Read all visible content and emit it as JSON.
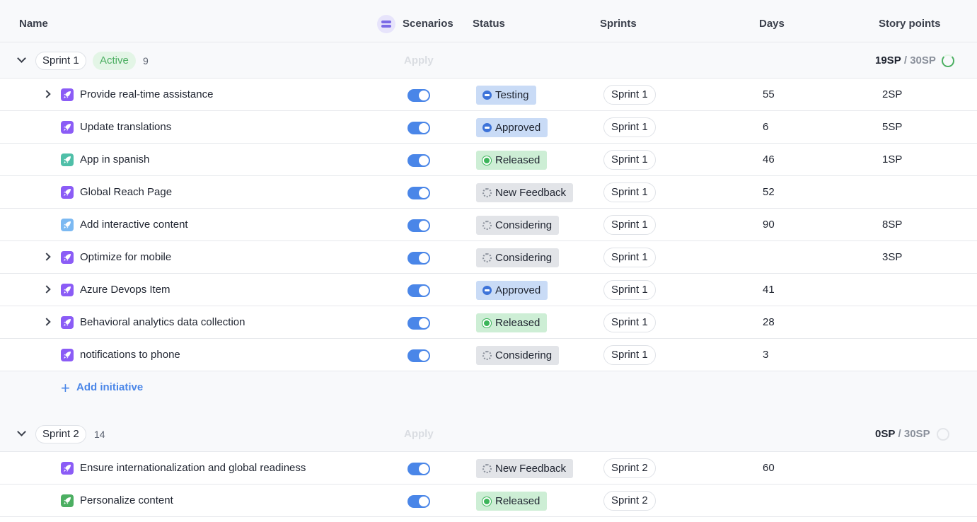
{
  "columns": {
    "name": "Name",
    "scenarios": "Scenarios",
    "status": "Status",
    "sprints": "Sprints",
    "days": "Days",
    "story_points": "Story points"
  },
  "colors": {
    "accent": "#4a86e8",
    "status_blue": "#3d73d9",
    "status_green": "#3cb55a",
    "status_grey": "#8a909b",
    "type_purple": "#8b5cf6",
    "type_teal": "#4fbfa8",
    "type_lightblue": "#7cb9f2",
    "type_green": "#4caf62"
  },
  "groups": [
    {
      "sprint": "Sprint 1",
      "badge": "Active",
      "count": "9",
      "apply": "Apply",
      "sp_used": "19SP",
      "sp_sep": "/",
      "sp_total": "30SP",
      "items": [
        {
          "name": "Provide real-time assistance",
          "expandable": true,
          "type_icon": "rocket-icon",
          "type_color": "#8b5cf6",
          "status": "Testing",
          "status_kind": "blue",
          "sprint": "Sprint 1",
          "days": "55",
          "points": "2SP"
        },
        {
          "name": "Update translations",
          "expandable": false,
          "type_icon": "rocket-icon",
          "type_color": "#8b5cf6",
          "status": "Approved",
          "status_kind": "blue",
          "sprint": "Sprint 1",
          "days": "6",
          "points": "5SP"
        },
        {
          "name": "App in spanish",
          "expandable": false,
          "type_icon": "rocket-icon",
          "type_color": "#4fbfa8",
          "status": "Released",
          "status_kind": "green",
          "sprint": "Sprint 1",
          "days": "46",
          "points": "1SP"
        },
        {
          "name": "Global Reach Page",
          "expandable": false,
          "type_icon": "rocket-icon",
          "type_color": "#8b5cf6",
          "status": "New Feedback",
          "status_kind": "grey",
          "sprint": "Sprint 1",
          "days": "52",
          "points": ""
        },
        {
          "name": "Add interactive content",
          "expandable": false,
          "type_icon": "rocket-icon",
          "type_color": "#7cb9f2",
          "status": "Considering",
          "status_kind": "grey",
          "sprint": "Sprint 1",
          "days": "90",
          "points": "8SP"
        },
        {
          "name": "Optimize for mobile",
          "expandable": true,
          "type_icon": "rocket-icon",
          "type_color": "#8b5cf6",
          "status": "Considering",
          "status_kind": "grey",
          "sprint": "Sprint 1",
          "days": "",
          "points": "3SP"
        },
        {
          "name": "Azure Devops Item",
          "expandable": true,
          "type_icon": "rocket-icon",
          "type_color": "#8b5cf6",
          "status": "Approved",
          "status_kind": "blue",
          "sprint": "Sprint 1",
          "days": "41",
          "points": ""
        },
        {
          "name": "Behavioral analytics data collection",
          "expandable": true,
          "type_icon": "rocket-icon",
          "type_color": "#8b5cf6",
          "status": "Released",
          "status_kind": "green",
          "sprint": "Sprint 1",
          "days": "28",
          "points": ""
        },
        {
          "name": "notifications to phone",
          "expandable": false,
          "type_icon": "rocket-icon",
          "type_color": "#8b5cf6",
          "status": "Considering",
          "status_kind": "grey",
          "sprint": "Sprint 1",
          "days": "3",
          "points": ""
        }
      ],
      "add_label": "Add initiative"
    },
    {
      "sprint": "Sprint 2",
      "badge": "",
      "count": "14",
      "apply": "Apply",
      "sp_used": "0SP",
      "sp_sep": "/",
      "sp_total": "30SP",
      "items": [
        {
          "name": "Ensure internationalization and global readiness",
          "expandable": false,
          "type_icon": "rocket-icon",
          "type_color": "#8b5cf6",
          "status": "New Feedback",
          "status_kind": "grey",
          "sprint": "Sprint 2",
          "days": "60",
          "points": ""
        },
        {
          "name": "Personalize content",
          "expandable": false,
          "type_icon": "rocket-icon",
          "type_color": "#4caf62",
          "status": "Released",
          "status_kind": "green",
          "sprint": "Sprint 2",
          "days": "",
          "points": ""
        }
      ]
    }
  ]
}
